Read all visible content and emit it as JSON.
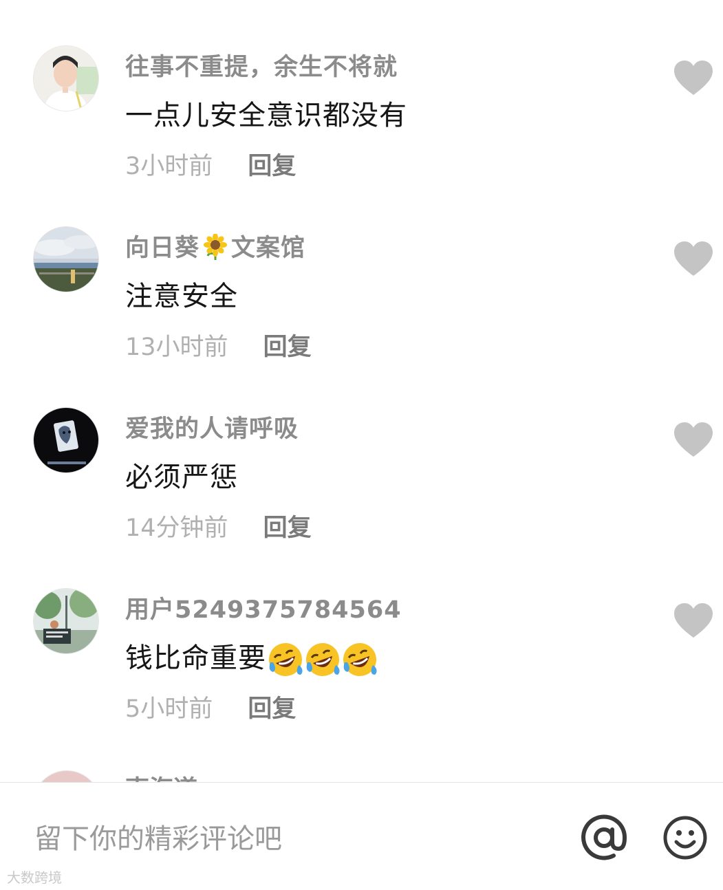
{
  "comments": [
    {
      "username": "往事不重提，余生不将就",
      "text": "一点儿安全意识都没有",
      "time": "3小时前",
      "reply_label": "回复",
      "avatar_icon": "avatar-photo-woman"
    },
    {
      "username_before": "向日葵",
      "username_after": "文案馆",
      "username_emoji": "sunflower-emoji",
      "text": "注意安全",
      "time": "13小时前",
      "reply_label": "回复",
      "avatar_icon": "avatar-photo-landscape"
    },
    {
      "username": "爱我的人请呼吸",
      "text": "必须严惩",
      "time": "14分钟前",
      "reply_label": "回复",
      "avatar_icon": "avatar-photo-joker"
    },
    {
      "username": "用户5249375784564",
      "text": "钱比命重要",
      "text_emojis": [
        "rolling-laughing-emoji",
        "rolling-laughing-emoji",
        "rolling-laughing-emoji"
      ],
      "time": "5小时前",
      "reply_label": "回复",
      "avatar_icon": "avatar-photo-park"
    }
  ],
  "partial_comment": {
    "username": "南海道"
  },
  "like_icon": "heart-icon",
  "input": {
    "placeholder": "留下你的精彩评论吧"
  },
  "at_icon": "at-icon",
  "emoji_icon": "smiley-icon",
  "watermark": "大数跨境",
  "colors": {
    "username": "#8b8b8b",
    "text": "#161616",
    "time": "#b0b0b0",
    "reply": "#7a7a7a",
    "heart": "#c4c4c4"
  }
}
